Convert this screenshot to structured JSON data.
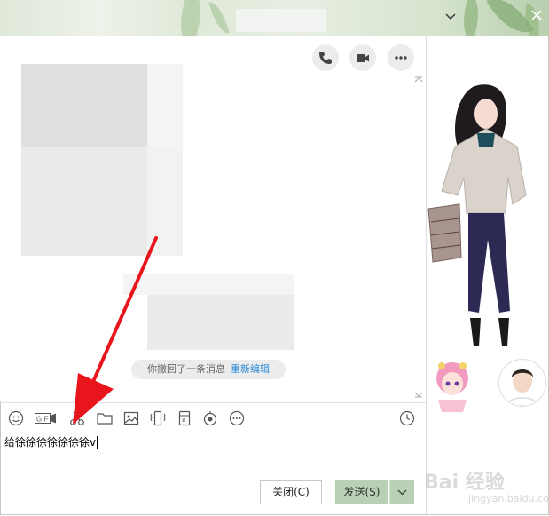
{
  "titlebar": {
    "minimize_icon": "chevron-down-icon",
    "close_icon": "close-icon"
  },
  "header_actions": [
    {
      "name": "voice-call-button",
      "icon": "phone-icon"
    },
    {
      "name": "video-call-button",
      "icon": "video-camera-icon"
    },
    {
      "name": "more-options-button",
      "icon": "ellipsis-icon"
    }
  ],
  "chat": {
    "recall_notice": "你撤回了一条消息",
    "recall_edit_link": "重新编辑"
  },
  "toolbar": {
    "icons": [
      "emoji-icon",
      "gif-icon",
      "scissors-icon",
      "folder-icon",
      "image-icon",
      "shake-icon",
      "red-envelope-icon",
      "voice-icon",
      "more-icon"
    ],
    "gif_label": "GIF",
    "history_icon": "clock-icon"
  },
  "input": {
    "text": "给徐徐徐徐徐徐徐v"
  },
  "actions": {
    "close_label": "关闭(C)",
    "send_label": "发送(S)"
  },
  "watermark": {
    "brand": "Bai 经验",
    "sub": "jingyan.baidu.com"
  },
  "colors": {
    "accent_link": "#2a8ad8",
    "send_button": "#b8d0b4",
    "arrow": "#e8161c"
  }
}
